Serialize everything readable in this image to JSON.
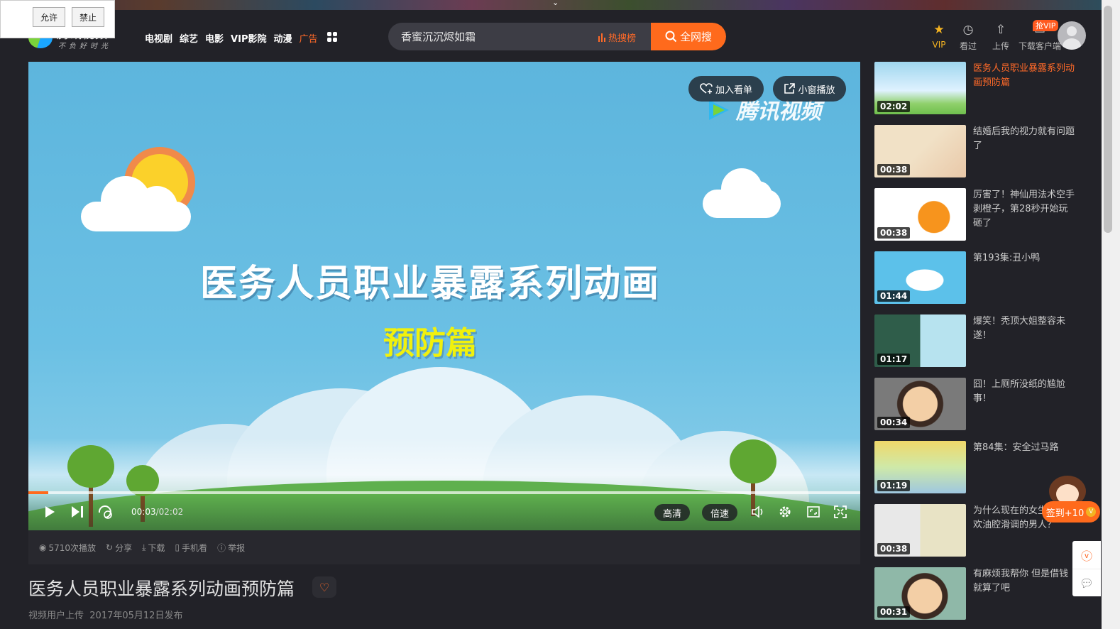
{
  "permission": {
    "allow": "允许",
    "deny": "禁止"
  },
  "logo": {
    "brand": "腾讯视频",
    "slogan": "不负好时光"
  },
  "nav": [
    "电视剧",
    "综艺",
    "电影",
    "VIP影院",
    "动漫",
    "广告"
  ],
  "search": {
    "value": "香蜜沉沉烬如霜",
    "hot": "热搜榜",
    "button": "全网搜"
  },
  "tools": {
    "vip": "VIP",
    "history": "看过",
    "upload": "上传",
    "client": "下载客户端",
    "vip_badge": "抢VIP"
  },
  "player": {
    "watermark": "腾讯视频",
    "headline": "医务人员职业暴露系列动画",
    "subheadline": "预防篇",
    "watchlist": "加入看单",
    "mini_play": "小窗播放",
    "current_time": "00:03",
    "duration": "/02:02",
    "progress": 0.024,
    "hd": "高清",
    "speed": "倍速"
  },
  "meta": {
    "plays": "5710次播放",
    "share": "分享",
    "download": "下载",
    "mobile": "手机看",
    "report": "举报"
  },
  "video": {
    "title": "医务人员职业暴露系列动画预防篇",
    "uploader": "视频用户上传",
    "published": "2017年05月12日发布"
  },
  "playlist": [
    {
      "title": "医务人员职业暴露系列动画预防篇",
      "duration": "02:02",
      "active": true
    },
    {
      "title": "结婚后我的视力就有问题了",
      "duration": "00:38"
    },
    {
      "title": "厉害了！神仙用法术空手剥橙子，第28秒开始玩砸了",
      "duration": "00:38"
    },
    {
      "title": "第193集:丑小鸭",
      "duration": "01:44"
    },
    {
      "title": "爆笑！秃顶大姐整容未遂！",
      "duration": "01:17"
    },
    {
      "title": "囧！上厕所没纸的尴尬事！",
      "duration": "00:34"
    },
    {
      "title": "第84集：安全过马路",
      "duration": "01:19"
    },
    {
      "title": "为什么现在的女生都不喜欢油腔滑调的男人？",
      "duration": "00:38"
    },
    {
      "title": "有麻烦我帮你 但是借钱就算了吧",
      "duration": "00:31"
    }
  ],
  "checkin": {
    "label": "签到+10",
    "coin": "V"
  },
  "colors": {
    "accent": "#ff6a1c",
    "background": "#222228",
    "sky": "#62b9e0"
  }
}
